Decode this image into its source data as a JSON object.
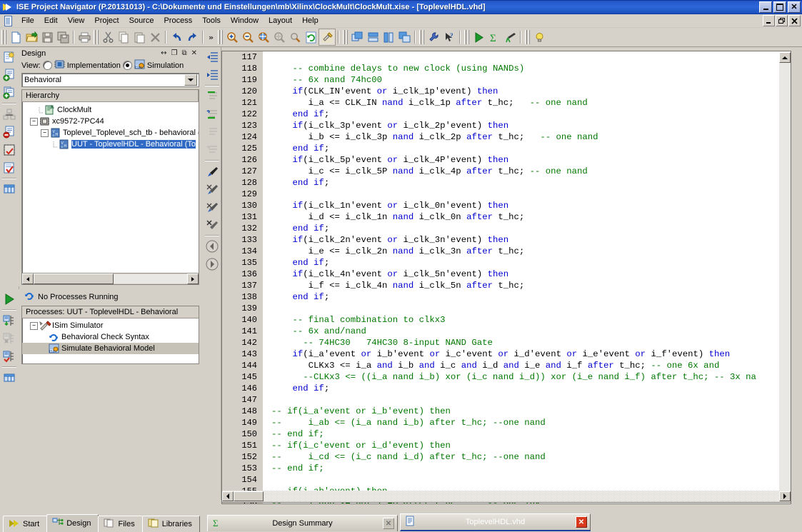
{
  "window": {
    "title": "ISE Project Navigator (P.20131013) - C:\\Dokumente und Einstellungen\\mb\\Xilinx\\ClockMult\\ClockMult.xise - [ToplevelHDL.vhd]",
    "minimize": "_",
    "maximize": "□",
    "close": "✕"
  },
  "menu": {
    "items": [
      "File",
      "Edit",
      "View",
      "Project",
      "Source",
      "Process",
      "Tools",
      "Window",
      "Layout",
      "Help"
    ],
    "doc_minimize": "_",
    "doc_restore": "❐",
    "doc_close": "✕"
  },
  "toolbar": {
    "overflow": "»",
    "groups": [
      {
        "icons": [
          "new-file-icon",
          "open-folder-icon",
          "save-icon",
          "save-all-icon"
        ]
      },
      {
        "icons": [
          "print-icon"
        ]
      },
      {
        "icons": [
          "cut-icon",
          "copy-icon",
          "paste-icon",
          "delete-icon",
          "undo-icon",
          "redo-icon"
        ]
      },
      {
        "icons": [
          "zoom-in-icon",
          "zoom-out-icon",
          "zoom-fit-icon",
          "zoom-selection-icon",
          "zoom-region-icon",
          "refresh-icon",
          "build-hammer-icon"
        ]
      },
      {
        "icons": [
          "tile-cascade-icon",
          "tile-horizontal-icon",
          "tile-vertical-icon",
          "arrange-icon"
        ]
      },
      {
        "icons": [
          "settings-wrench-icon",
          "whats-this-help-icon"
        ]
      },
      {
        "icons": [
          "run-icon",
          "sum-icon",
          "telescope-icon"
        ]
      },
      {
        "icons": [
          "smart-guide-bulb-icon"
        ]
      }
    ]
  },
  "design_panel": {
    "title": "Design",
    "header_buttons": [
      "resize-icon",
      "maximize-icon",
      "restore-icon",
      "close-icon"
    ],
    "view_label": "View:",
    "view_options": [
      {
        "label": "Implementation",
        "selected": false,
        "icon": "chip-icon"
      },
      {
        "label": "Simulation",
        "selected": true,
        "icon": "isim-icon"
      }
    ],
    "combo_value": "Behavioral",
    "hierarchy_header": "Hierarchy",
    "tree": [
      {
        "label": "ClockMult",
        "depth": 0,
        "icon": "project-icon",
        "expander": "none",
        "selected": false
      },
      {
        "label": "xc9572-7PC44",
        "depth": 0,
        "icon": "device-icon",
        "expander": "minus",
        "selected": false
      },
      {
        "label": "Toplevel_Toplevel_sch_tb - behavioral (To",
        "depth": 1,
        "icon": "vhdl-icon",
        "expander": "minus",
        "selected": false
      },
      {
        "label": "UUT - ToplevelHDL - Behavioral (To",
        "depth": 2,
        "icon": "vhdl-icon",
        "expander": "none",
        "selected": true
      }
    ]
  },
  "processes_panel": {
    "status_text": "No Processes Running",
    "status_icon": "refresh-icon",
    "header": "Processes: UUT - ToplevelHDL - Behavioral",
    "rows": [
      {
        "label": "ISim Simulator",
        "depth": 0,
        "icon": "simulator-icon",
        "expander": "minus",
        "highlighted": false
      },
      {
        "label": "Behavioral Check Syntax",
        "depth": 1,
        "icon": "refresh-icon",
        "expander": "none",
        "highlighted": false
      },
      {
        "label": "Simulate Behavioral Model",
        "depth": 1,
        "icon": "isim-icon",
        "expander": "none",
        "highlighted": true
      }
    ]
  },
  "left_rail_top": [
    "new-source-icon",
    "add-source-icon",
    "add-copy-source-icon",
    "manage-config-icon",
    "remove-source-icon",
    "design-utilities-icon",
    "check-syntax-icon",
    "view-panel-icon"
  ],
  "left_rail_bottom": [
    "run-process-icon",
    "implement-top-icon",
    "stop-process-icon",
    "check-process-icon",
    "view-panel-icon"
  ],
  "editor_rail": [
    "indent-left-icon",
    "indent-right-icon",
    "comment-icon",
    "uncomment-icon",
    "comment-disabled-icon",
    "uncomment-disabled-icon",
    "bookmark-toggle-icon",
    "bookmark-prev-icon",
    "bookmark-next-icon",
    "bookmark-clear-icon",
    "nav-back-icon",
    "nav-forward-icon"
  ],
  "editor": {
    "first_line": 117,
    "lines": [
      {
        "n": 117,
        "tokens": []
      },
      {
        "n": 118,
        "tokens": [
          {
            "t": "    ",
            "c": "pl"
          },
          {
            "t": "-- combine delays to new clock (using NANDs)",
            "c": "cm"
          }
        ]
      },
      {
        "n": 119,
        "tokens": [
          {
            "t": "    ",
            "c": "pl"
          },
          {
            "t": "-- 6x nand 74hc00",
            "c": "cm"
          }
        ]
      },
      {
        "n": 120,
        "tokens": [
          {
            "t": "    ",
            "c": "pl"
          },
          {
            "t": "if",
            "c": "kw"
          },
          {
            "t": "(CLK_IN'event ",
            "c": "pl"
          },
          {
            "t": "or",
            "c": "kw"
          },
          {
            "t": " i_clk_1p'event) ",
            "c": "pl"
          },
          {
            "t": "then",
            "c": "kw"
          }
        ]
      },
      {
        "n": 121,
        "tokens": [
          {
            "t": "       i_a <= CLK_IN ",
            "c": "pl"
          },
          {
            "t": "nand",
            "c": "kw"
          },
          {
            "t": " i_clk_1p ",
            "c": "pl"
          },
          {
            "t": "after",
            "c": "kw"
          },
          {
            "t": " t_hc;   ",
            "c": "pl"
          },
          {
            "t": "-- one nand",
            "c": "cm"
          }
        ]
      },
      {
        "n": 122,
        "tokens": [
          {
            "t": "    ",
            "c": "pl"
          },
          {
            "t": "end if",
            "c": "kw"
          },
          {
            "t": ";",
            "c": "pl"
          }
        ]
      },
      {
        "n": 123,
        "tokens": [
          {
            "t": "    ",
            "c": "pl"
          },
          {
            "t": "if",
            "c": "kw"
          },
          {
            "t": "(i_clk_3p'event ",
            "c": "pl"
          },
          {
            "t": "or",
            "c": "kw"
          },
          {
            "t": " i_clk_2p'event) ",
            "c": "pl"
          },
          {
            "t": "then",
            "c": "kw"
          }
        ]
      },
      {
        "n": 124,
        "tokens": [
          {
            "t": "       i_b <= i_clk_3p ",
            "c": "pl"
          },
          {
            "t": "nand",
            "c": "kw"
          },
          {
            "t": " i_clk_2p ",
            "c": "pl"
          },
          {
            "t": "after",
            "c": "kw"
          },
          {
            "t": " t_hc;   ",
            "c": "pl"
          },
          {
            "t": "-- one nand",
            "c": "cm"
          }
        ]
      },
      {
        "n": 125,
        "tokens": [
          {
            "t": "    ",
            "c": "pl"
          },
          {
            "t": "end if",
            "c": "kw"
          },
          {
            "t": ";",
            "c": "pl"
          }
        ]
      },
      {
        "n": 126,
        "tokens": [
          {
            "t": "    ",
            "c": "pl"
          },
          {
            "t": "if",
            "c": "kw"
          },
          {
            "t": "(i_clk_5p'event ",
            "c": "pl"
          },
          {
            "t": "or",
            "c": "kw"
          },
          {
            "t": " i_clk_4P'event) ",
            "c": "pl"
          },
          {
            "t": "then",
            "c": "kw"
          }
        ]
      },
      {
        "n": 127,
        "tokens": [
          {
            "t": "       i_c <= i_clk_5P ",
            "c": "pl"
          },
          {
            "t": "nand",
            "c": "kw"
          },
          {
            "t": " i_clk_4p ",
            "c": "pl"
          },
          {
            "t": "after",
            "c": "kw"
          },
          {
            "t": " t_hc; ",
            "c": "pl"
          },
          {
            "t": "-- one nand",
            "c": "cm"
          }
        ]
      },
      {
        "n": 128,
        "tokens": [
          {
            "t": "    ",
            "c": "pl"
          },
          {
            "t": "end if",
            "c": "kw"
          },
          {
            "t": ";",
            "c": "pl"
          }
        ]
      },
      {
        "n": 129,
        "tokens": []
      },
      {
        "n": 130,
        "tokens": [
          {
            "t": "    ",
            "c": "pl"
          },
          {
            "t": "if",
            "c": "kw"
          },
          {
            "t": "(i_clk_1n'event ",
            "c": "pl"
          },
          {
            "t": "or",
            "c": "kw"
          },
          {
            "t": " i_clk_0n'event) ",
            "c": "pl"
          },
          {
            "t": "then",
            "c": "kw"
          }
        ]
      },
      {
        "n": 131,
        "tokens": [
          {
            "t": "       i_d <= i_clk_1n ",
            "c": "pl"
          },
          {
            "t": "nand",
            "c": "kw"
          },
          {
            "t": " i_clk_0n ",
            "c": "pl"
          },
          {
            "t": "after",
            "c": "kw"
          },
          {
            "t": " t_hc;",
            "c": "pl"
          }
        ]
      },
      {
        "n": 132,
        "tokens": [
          {
            "t": "    ",
            "c": "pl"
          },
          {
            "t": "end if",
            "c": "kw"
          },
          {
            "t": ";",
            "c": "pl"
          }
        ]
      },
      {
        "n": 133,
        "tokens": [
          {
            "t": "    ",
            "c": "pl"
          },
          {
            "t": "if",
            "c": "kw"
          },
          {
            "t": "(i_clk_2n'event ",
            "c": "pl"
          },
          {
            "t": "or",
            "c": "kw"
          },
          {
            "t": " i_clk_3n'event) ",
            "c": "pl"
          },
          {
            "t": "then",
            "c": "kw"
          }
        ]
      },
      {
        "n": 134,
        "tokens": [
          {
            "t": "       i_e <= i_clk_2n ",
            "c": "pl"
          },
          {
            "t": "nand",
            "c": "kw"
          },
          {
            "t": " i_clk_3n ",
            "c": "pl"
          },
          {
            "t": "after",
            "c": "kw"
          },
          {
            "t": " t_hc;",
            "c": "pl"
          }
        ]
      },
      {
        "n": 135,
        "tokens": [
          {
            "t": "    ",
            "c": "pl"
          },
          {
            "t": "end if",
            "c": "kw"
          },
          {
            "t": ";",
            "c": "pl"
          }
        ]
      },
      {
        "n": 136,
        "tokens": [
          {
            "t": "    ",
            "c": "pl"
          },
          {
            "t": "if",
            "c": "kw"
          },
          {
            "t": "(i_clk_4n'event ",
            "c": "pl"
          },
          {
            "t": "or",
            "c": "kw"
          },
          {
            "t": " i_clk_5n'event) ",
            "c": "pl"
          },
          {
            "t": "then",
            "c": "kw"
          }
        ]
      },
      {
        "n": 137,
        "tokens": [
          {
            "t": "       i_f <= i_clk_4n ",
            "c": "pl"
          },
          {
            "t": "nand",
            "c": "kw"
          },
          {
            "t": " i_clk_5n ",
            "c": "pl"
          },
          {
            "t": "after",
            "c": "kw"
          },
          {
            "t": " t_hc;",
            "c": "pl"
          }
        ]
      },
      {
        "n": 138,
        "tokens": [
          {
            "t": "    ",
            "c": "pl"
          },
          {
            "t": "end if",
            "c": "kw"
          },
          {
            "t": ";",
            "c": "pl"
          }
        ]
      },
      {
        "n": 139,
        "tokens": []
      },
      {
        "n": 140,
        "tokens": [
          {
            "t": "    ",
            "c": "pl"
          },
          {
            "t": "-- final combination to clkx3",
            "c": "cm"
          }
        ]
      },
      {
        "n": 141,
        "tokens": [
          {
            "t": "    ",
            "c": "pl"
          },
          {
            "t": "-- 6x and/nand",
            "c": "cm"
          }
        ]
      },
      {
        "n": 142,
        "tokens": [
          {
            "t": "      ",
            "c": "pl"
          },
          {
            "t": "-- 74HC30   74HC30 8-input NAND Gate",
            "c": "cm"
          }
        ]
      },
      {
        "n": 143,
        "tokens": [
          {
            "t": "    ",
            "c": "pl"
          },
          {
            "t": "if",
            "c": "kw"
          },
          {
            "t": "(i_a'event ",
            "c": "pl"
          },
          {
            "t": "or",
            "c": "kw"
          },
          {
            "t": " i_b'event ",
            "c": "pl"
          },
          {
            "t": "or",
            "c": "kw"
          },
          {
            "t": " i_c'event ",
            "c": "pl"
          },
          {
            "t": "or",
            "c": "kw"
          },
          {
            "t": " i_d'event ",
            "c": "pl"
          },
          {
            "t": "or",
            "c": "kw"
          },
          {
            "t": " i_e'event ",
            "c": "pl"
          },
          {
            "t": "or",
            "c": "kw"
          },
          {
            "t": " i_f'event) ",
            "c": "pl"
          },
          {
            "t": "then",
            "c": "kw"
          }
        ]
      },
      {
        "n": 144,
        "tokens": [
          {
            "t": "       CLKx3 <= i_a ",
            "c": "pl"
          },
          {
            "t": "and",
            "c": "kw"
          },
          {
            "t": " i_b ",
            "c": "pl"
          },
          {
            "t": "and",
            "c": "kw"
          },
          {
            "t": " i_c ",
            "c": "pl"
          },
          {
            "t": "and",
            "c": "kw"
          },
          {
            "t": " i_d ",
            "c": "pl"
          },
          {
            "t": "and",
            "c": "kw"
          },
          {
            "t": " i_e ",
            "c": "pl"
          },
          {
            "t": "and",
            "c": "kw"
          },
          {
            "t": " i_f ",
            "c": "pl"
          },
          {
            "t": "after",
            "c": "kw"
          },
          {
            "t": " t_hc; ",
            "c": "pl"
          },
          {
            "t": "-- one 6x and",
            "c": "cm"
          }
        ]
      },
      {
        "n": 145,
        "tokens": [
          {
            "t": "      ",
            "c": "pl"
          },
          {
            "t": "--CLKx3 <= ((i_a nand i_b) xor (i_c nand i_d)) xor (i_e nand i_f) after t_hc; -- 3x na",
            "c": "cm"
          }
        ]
      },
      {
        "n": 146,
        "tokens": [
          {
            "t": "    ",
            "c": "pl"
          },
          {
            "t": "end if",
            "c": "kw"
          },
          {
            "t": ";",
            "c": "pl"
          }
        ]
      },
      {
        "n": 147,
        "tokens": []
      },
      {
        "n": 148,
        "tokens": [
          {
            "t": "-- if(i_a'event or i_b'event) then",
            "c": "cm"
          }
        ]
      },
      {
        "n": 149,
        "tokens": [
          {
            "t": "--     i_ab <= (i_a nand i_b) after t_hc; --one nand",
            "c": "cm"
          }
        ]
      },
      {
        "n": 150,
        "tokens": [
          {
            "t": "-- end if;",
            "c": "cm"
          }
        ]
      },
      {
        "n": 151,
        "tokens": [
          {
            "t": "-- if(i_c'event or i_d'event) then",
            "c": "cm"
          }
        ]
      },
      {
        "n": 152,
        "tokens": [
          {
            "t": "--     i_cd <= (i_c nand i_d) after t_hc; --one nand",
            "c": "cm"
          }
        ]
      },
      {
        "n": 153,
        "tokens": [
          {
            "t": "-- end if;",
            "c": "cm"
          }
        ]
      },
      {
        "n": 154,
        "tokens": []
      },
      {
        "n": 155,
        "tokens": [
          {
            "t": "-- if(i_ab'event) then",
            "c": "cm"
          }
        ]
      },
      {
        "n": 156,
        "tokens": [
          {
            "t": "--     i_abn <= not i_AB after t_hc;     -- one inv",
            "c": "cm"
          }
        ]
      }
    ]
  },
  "bottom_tabs": {
    "left": [
      {
        "label": "Start",
        "icon": "start-arrow-icon",
        "active": false
      },
      {
        "label": "Design",
        "icon": "design-icon",
        "active": true
      },
      {
        "label": "Files",
        "icon": "files-icon",
        "active": false
      },
      {
        "label": "Libraries",
        "icon": "libraries-icon",
        "active": false
      }
    ],
    "documents": [
      {
        "label": "Design Summary",
        "icon": "summary-sigma-icon",
        "close": "✕",
        "selected": false
      },
      {
        "label": "ToplevelHDL.vhd",
        "icon": "vhd-doc-icon",
        "close": "✕",
        "selected": true
      }
    ]
  },
  "colors": {
    "keyword": "#0000d0",
    "comment": "#007800",
    "plain": "#000000",
    "selection": "#316ac5",
    "titlebar": "#2d66d8",
    "chrome": "#d4d0c8"
  }
}
